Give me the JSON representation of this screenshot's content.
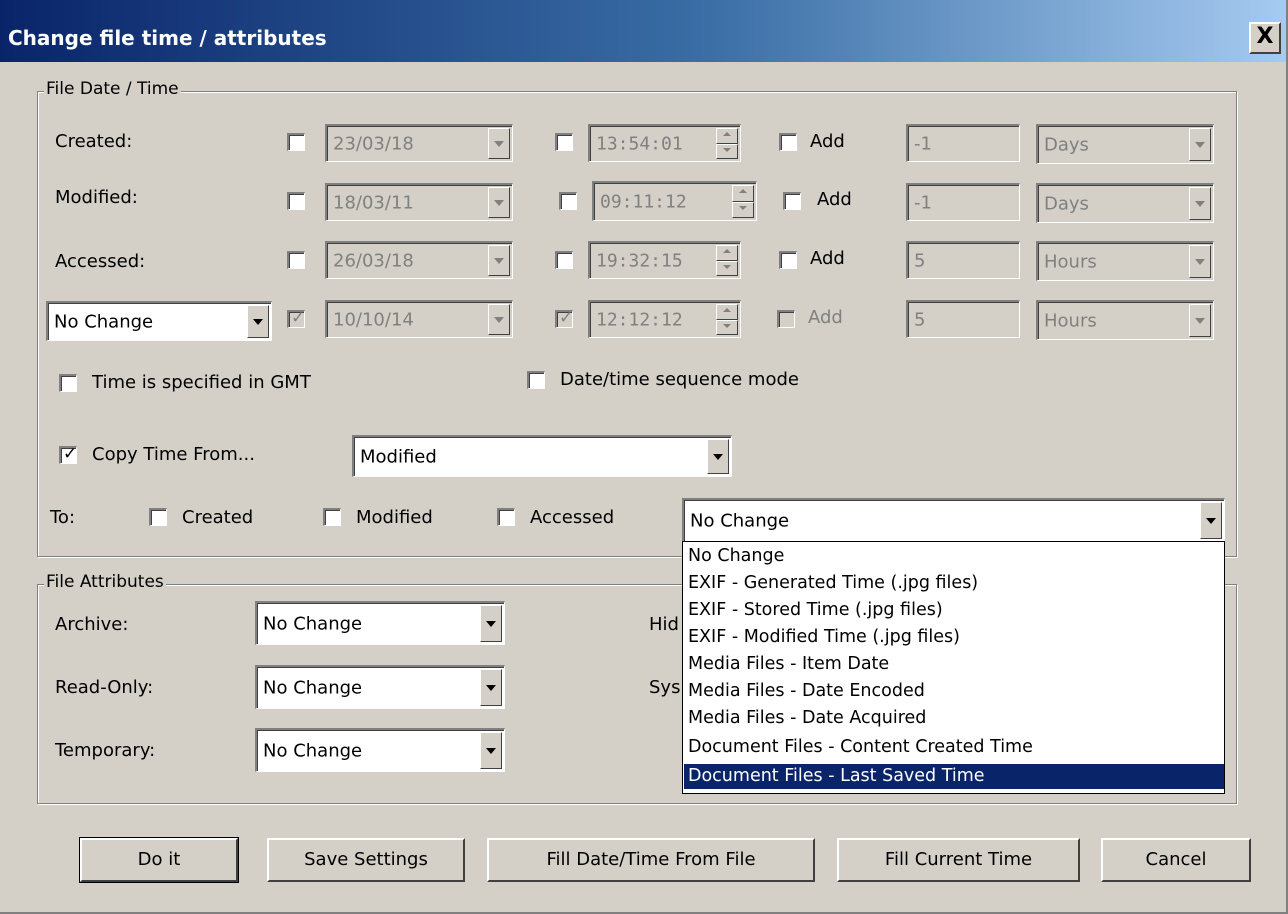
{
  "window": {
    "title": "Change file time / attributes",
    "close_label": "X"
  },
  "date_time_group": {
    "legend": "File Date / Time",
    "rows": [
      {
        "label": "Created:",
        "date": "23/03/18",
        "time": "13:54:01",
        "add_label": "Add",
        "add_value": "-1",
        "unit": "Days"
      },
      {
        "label": "Modified:",
        "date": "18/03/11",
        "time": "09:11:12",
        "add_label": "Add",
        "add_value": "-1",
        "unit": "Days"
      },
      {
        "label": "Accessed:",
        "date": "26/03/18",
        "time": "19:32:15",
        "add_label": "Add",
        "add_value": "5",
        "unit": "Hours"
      },
      {
        "label": "No Change",
        "date": "10/10/14",
        "time": "12:12:12",
        "add_label": "Add",
        "add_value": "5",
        "unit": "Hours"
      }
    ],
    "gmt_label": "Time is specified in GMT",
    "sequence_label": "Date/time sequence mode",
    "copy_time_label": "Copy Time From...",
    "copy_from_value": "Modified",
    "to_label": "To:",
    "to_created": "Created",
    "to_modified": "Modified",
    "to_accessed": "Accessed",
    "to_select_value": "No Change"
  },
  "dropdown": {
    "options": [
      "No Change",
      "EXIF - Generated Time (.jpg files)",
      "EXIF - Stored Time (.jpg files)",
      "EXIF - Modified Time (.jpg files)",
      "Media Files - Item Date",
      "Media Files - Date Encoded",
      "Media Files - Date Acquired",
      "Document Files - Content Created Time",
      "Document Files - Last Saved Time"
    ],
    "selected_index": 8
  },
  "attributes_group": {
    "legend": "File Attributes",
    "archive_label": "Archive:",
    "archive_value": "No Change",
    "readonly_label": "Read-Only:",
    "readonly_value": "No Change",
    "temporary_label": "Temporary:",
    "temporary_value": "No Change",
    "hidden_label_partial": "Hid",
    "system_label_partial": "Sys"
  },
  "buttons": {
    "do_it": "Do it",
    "save_settings": "Save Settings",
    "fill_from_file": "Fill Date/Time From File",
    "fill_current": "Fill Current Time",
    "cancel": "Cancel"
  },
  "colors": {
    "dialog_bg": "#d4d0c8",
    "title_start": "#0a246a",
    "title_end": "#a6caf0",
    "selection": "#0a246a"
  }
}
